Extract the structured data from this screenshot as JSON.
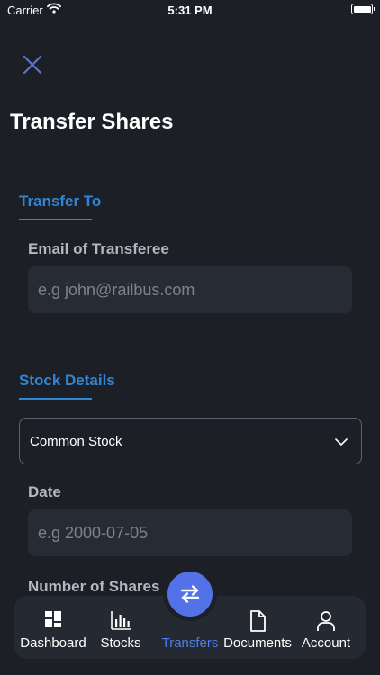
{
  "status_bar": {
    "carrier": "Carrier",
    "time": "5:31 PM"
  },
  "page": {
    "title": "Transfer Shares"
  },
  "transfer_to": {
    "section_title": "Transfer To",
    "email_label": "Email of Transferee",
    "email_placeholder": "e.g john@railbus.com",
    "email_value": ""
  },
  "stock_details": {
    "section_title": "Stock Details",
    "stock_type_selected": "Common Stock",
    "date_label": "Date",
    "date_placeholder": "e.g 2000-07-05",
    "date_value": "",
    "shares_label": "Number of Shares"
  },
  "tab_bar": {
    "tabs": [
      {
        "label": "Dashboard",
        "icon": "dashboard-icon"
      },
      {
        "label": "Stocks",
        "icon": "bar-chart-icon"
      },
      {
        "label": "Transfers",
        "icon": "transfer-arrows-icon",
        "active": true
      },
      {
        "label": "Documents",
        "icon": "document-icon"
      },
      {
        "label": "Account",
        "icon": "user-icon"
      }
    ]
  },
  "colors": {
    "background": "#1c1f26",
    "accent_blue": "#2f86d6",
    "active_tab": "#4f7cf0",
    "fab": "#5472e8",
    "input_background": "#272b33",
    "close_icon": "#5a72d8"
  }
}
